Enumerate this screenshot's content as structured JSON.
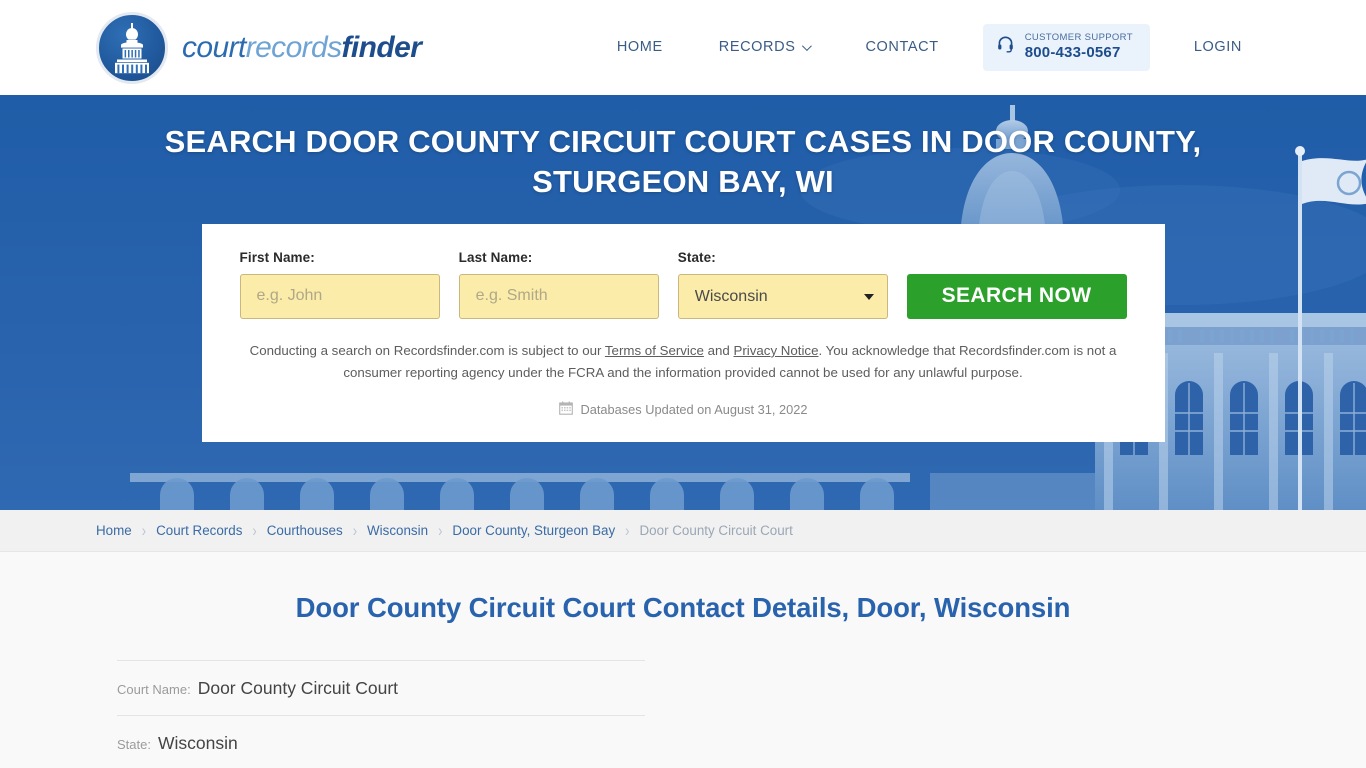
{
  "header": {
    "logo": {
      "icon": "capitol-dome-icon",
      "part1": "court",
      "part2": "records",
      "part3": "finder"
    },
    "nav": [
      {
        "label": "HOME",
        "has_chevron": false
      },
      {
        "label": "RECORDS",
        "has_chevron": true
      },
      {
        "label": "CONTACT",
        "has_chevron": false
      }
    ],
    "support": {
      "icon": "headset-icon",
      "label": "CUSTOMER SUPPORT",
      "phone": "800-433-0567"
    },
    "login_label": "LOGIN"
  },
  "hero": {
    "title": "SEARCH DOOR COUNTY CIRCUIT COURT CASES IN DOOR COUNTY, STURGEON BAY, WI",
    "background_color": "#2a63ad",
    "search": {
      "first_name": {
        "label": "First Name:",
        "value": "",
        "placeholder": "e.g. John"
      },
      "last_name": {
        "label": "Last Name:",
        "value": "",
        "placeholder": "e.g. Smith"
      },
      "state": {
        "label": "State:",
        "value": "Wisconsin"
      },
      "submit_label": "SEARCH NOW",
      "submit_color": "#2ba02b",
      "disclaimer": {
        "part1": "Conducting a search on Recordsfinder.com is subject to our ",
        "link1": "Terms of Service",
        "part2": " and ",
        "link2": "Privacy Notice",
        "part3": ". You acknowledge that Recordsfinder.com is not a consumer reporting agency under the FCRA and the information provided cannot be used for any unlawful purpose."
      },
      "updated": {
        "icon": "calendar-icon",
        "text": "Databases Updated on August 31, 2022"
      }
    }
  },
  "breadcrumb": {
    "separator": "›",
    "items": [
      {
        "label": "Home",
        "current": false
      },
      {
        "label": "Court Records",
        "current": false
      },
      {
        "label": "Courthouses",
        "current": false
      },
      {
        "label": "Wisconsin",
        "current": false
      },
      {
        "label": "Door County, Sturgeon Bay",
        "current": false
      },
      {
        "label": "Door County Circuit Court",
        "current": true
      }
    ]
  },
  "main": {
    "title": "Door County Circuit Court Contact Details, Door, Wisconsin",
    "title_color": "#2a63ad",
    "details": [
      {
        "label": "Court Name:",
        "value": "Door County Circuit Court"
      },
      {
        "label": "State:",
        "value": "Wisconsin"
      }
    ]
  }
}
